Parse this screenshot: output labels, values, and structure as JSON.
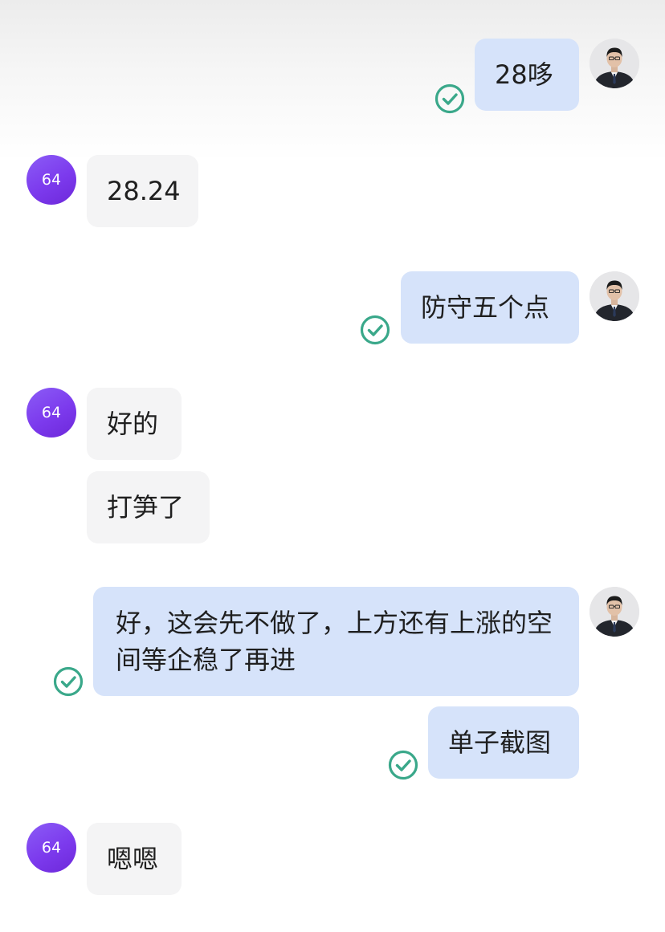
{
  "chat": {
    "contact_avatar_label": "64",
    "messages": [
      {
        "sender": "self",
        "text": "28哆",
        "status": "sent"
      },
      {
        "sender": "contact",
        "text": "28.24"
      },
      {
        "sender": "self",
        "text": "防守五个点",
        "status": "sent"
      },
      {
        "sender": "contact",
        "text": "好的"
      },
      {
        "sender": "contact",
        "text": "打笋了"
      },
      {
        "sender": "self",
        "text": "好，这会先不做了，上方还有上涨的空间等企稳了再进",
        "status": "sent"
      },
      {
        "sender": "self",
        "text": "单子截图",
        "status": "sent"
      },
      {
        "sender": "contact",
        "text": "嗯嗯"
      }
    ]
  },
  "colors": {
    "sent_bubble": "#d6e3fa",
    "received_bubble": "#f4f4f5",
    "read_check": "#3aa88a",
    "contact_avatar": "#7c3aed"
  },
  "icons": {
    "status": "check-circle-icon",
    "self_avatar": "user-photo-avatar"
  }
}
